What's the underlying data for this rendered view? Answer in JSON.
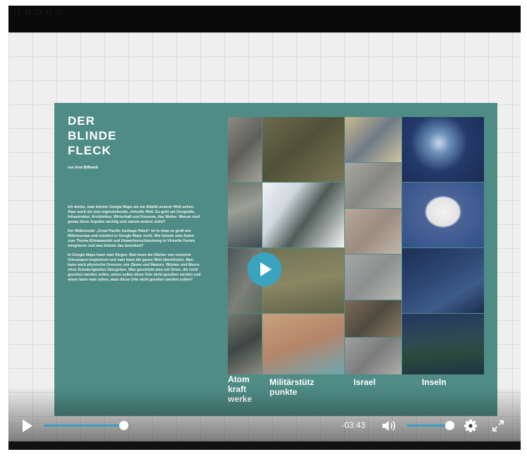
{
  "slide": {
    "title_lines": [
      "DER",
      "BLINDE",
      "FLECK"
    ],
    "author": "von Anni Billhardt",
    "paragraphs": [
      "Ich denke, man könnte Google Maps als ein Abbild unserer Welt sehen. Aber auch als eine eigenstehende, virtuelle Welt. Es geht um Geografie, Infrastruktur, Architektur, Wirtschaft und Konsum, das Wetter. Warum sind genau diese Aspekte wichtig und warum andere nicht?",
      "Der Müllstrudel „Great Pacific Garbage Patch“ ist in etwa so groß wie Mitteleuropa und existiert in Google Maps nicht. Wie könnte man Daten zum Thema Klimawandel und Umweltverschmutzung in Virtuelle Karten integrieren und was könnte das bewirken?",
      "In Google Maps kann man fliegen. Man kann die Dächer von unserem Unicampus inspizieren und man kann die ganze Welt überblicken. Man kann auch physische Grenzen, wie Zäune und Mauern, Wüsten und Meere, ohne Schwierigkeiten übergehen. Was geschieht also mit Orten, die nicht gesehen werden sollen, wieso sollen diese Orte nicht gesehen werden und wieso kann man sehen, dass diese Orte nicht gesehen werden sollen?"
    ],
    "columns": [
      {
        "label_lines": [
          "Atom",
          "kraft",
          "werke"
        ]
      },
      {
        "label_lines": [
          "Militärstütz",
          "punkte"
        ]
      },
      {
        "label_lines": [
          "Israel"
        ]
      },
      {
        "label_lines": [
          "Inseln"
        ]
      }
    ],
    "accent_color": "#4f8c86"
  },
  "player": {
    "play_icon": "play-icon",
    "time_remaining": "-03:43",
    "progress": 0.27,
    "volume": 0.95,
    "volume_icon": "volume-icon",
    "settings_icon": "gear-icon",
    "fullscreen_icon": "fullscreen-icon",
    "accent_color": "#3a9ec4"
  }
}
